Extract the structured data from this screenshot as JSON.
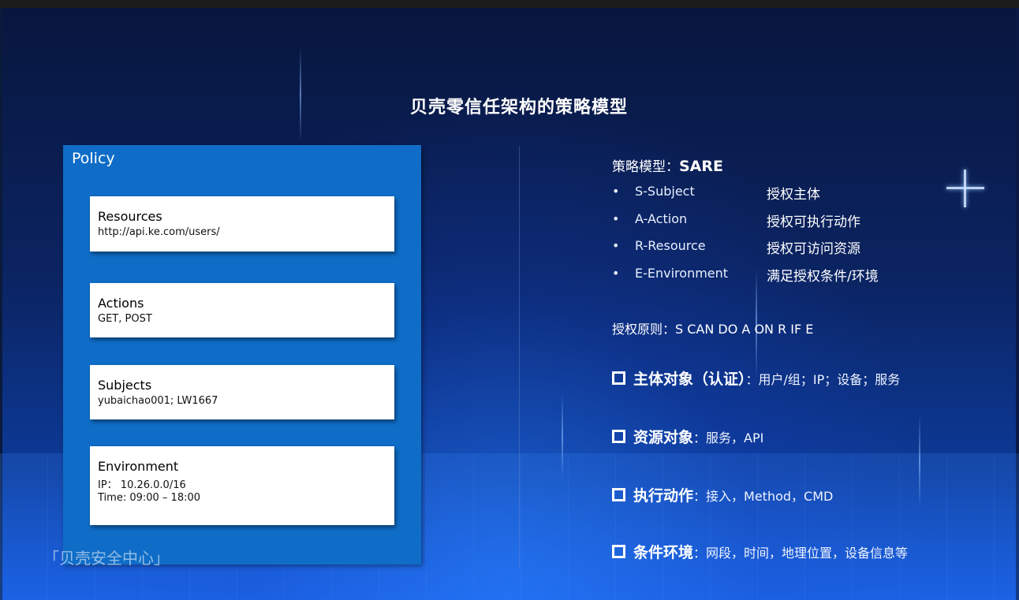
{
  "slide": {
    "title": "贝壳零信任架构的策略模型",
    "watermark": "「贝壳安全中心」"
  },
  "policy": {
    "title": "Policy",
    "cards": [
      {
        "title": "Resources",
        "lines": [
          "http://api.ke.com/users/"
        ]
      },
      {
        "title": "Actions",
        "lines": [
          "GET, POST"
        ]
      },
      {
        "title": "Subjects",
        "lines": [
          "yubaichao001; LW1667"
        ]
      },
      {
        "title": "Environment",
        "lines": [
          "IP：  10.26.0.0/16",
          "Time: 09:00 – 18:00"
        ]
      }
    ]
  },
  "model": {
    "label": "策略模型：",
    "value": "SARE",
    "bullet_glyph": "•",
    "items": [
      {
        "name": "S-Subject",
        "desc": "授权主体"
      },
      {
        "name": "A-Action",
        "desc": "授权可执行动作"
      },
      {
        "name": "R-Resource",
        "desc": "授权可访问资源"
      },
      {
        "name": "E-Environment",
        "desc": "满足授权条件/环境"
      }
    ],
    "principle": "授权原则：S CAN DO A ON R IF E"
  },
  "features": [
    {
      "name": "主体对象（认证）",
      "desc": "：用户/组；IP；设备；服务"
    },
    {
      "name": "资源对象",
      "desc": "：服务，API"
    },
    {
      "name": "执行动作",
      "desc": "：接入，Method，CMD"
    },
    {
      "name": "条件环境",
      "desc": "：网段，时间，地理位置，设备信息等"
    }
  ]
}
